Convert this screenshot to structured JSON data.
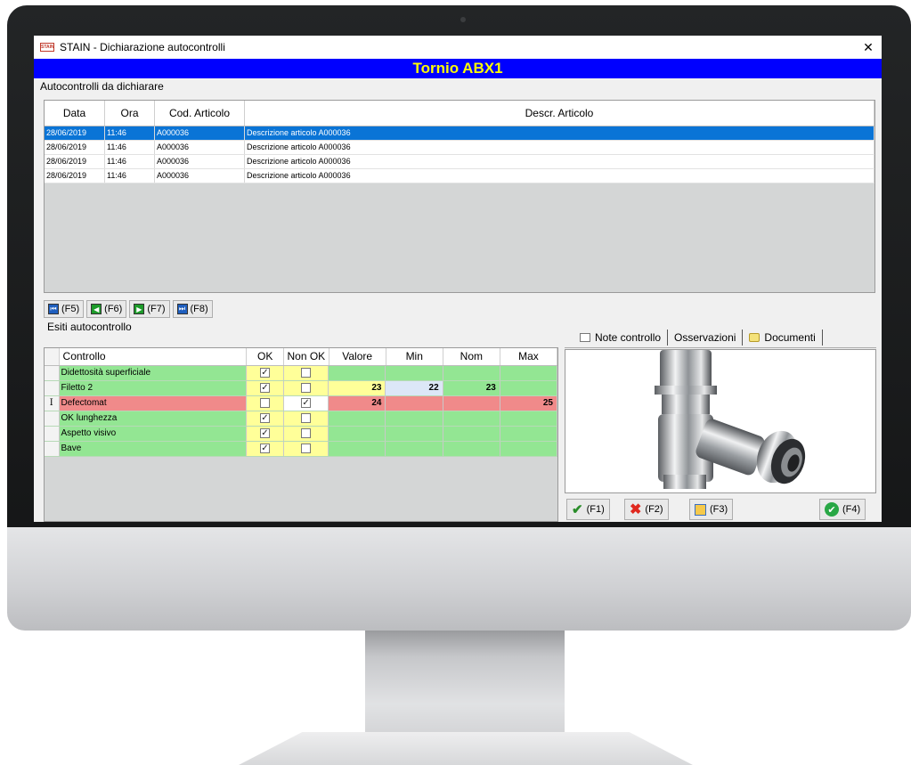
{
  "window": {
    "title": "STAIN - Dichiarazione autocontrolli",
    "app_logo_text": "STAIN",
    "close_glyph": "✕",
    "banner": "Tornio ABX1"
  },
  "pending": {
    "section_label": "Autocontrolli da dichiarare",
    "columns": [
      "Data",
      "Ora",
      "Cod. Articolo",
      "Descr. Articolo"
    ],
    "rows": [
      {
        "data": "28/06/2019",
        "ora": "11:46",
        "cod": "A000036",
        "descr": "Descrizione articolo A000036"
      },
      {
        "data": "28/06/2019",
        "ora": "11:46",
        "cod": "A000036",
        "descr": "Descrizione articolo A000036"
      },
      {
        "data": "28/06/2019",
        "ora": "11:46",
        "cod": "A000036",
        "descr": "Descrizione articolo A000036"
      },
      {
        "data": "28/06/2019",
        "ora": "11:46",
        "cod": "A000036",
        "descr": "Descrizione articolo A000036"
      }
    ],
    "selected_row": 0
  },
  "nav": {
    "first": "(F5)",
    "prev": "(F6)",
    "next": "(F7)",
    "last": "(F8)"
  },
  "results": {
    "section_label": "Esiti autocontrollo",
    "columns": [
      "Controllo",
      "OK",
      "Non OK",
      "Valore",
      "Min",
      "Nom",
      "Max"
    ],
    "rows": [
      {
        "controllo": "Didettosità superficiale",
        "ok": true,
        "nonok": false,
        "valore": "",
        "min": "",
        "nom": "",
        "max": "",
        "status": "ok"
      },
      {
        "controllo": "Filetto 2",
        "ok": true,
        "nonok": false,
        "valore": "23",
        "min": "22",
        "nom": "23",
        "max": "",
        "status": "ok"
      },
      {
        "controllo": "Defectomat",
        "ok": false,
        "nonok": true,
        "valore": "24",
        "min": "",
        "nom": "",
        "max": "25",
        "status": "ko",
        "row_marker": "I"
      },
      {
        "controllo": "OK lunghezza",
        "ok": true,
        "nonok": false,
        "valore": "",
        "min": "",
        "nom": "",
        "max": "",
        "status": "ok"
      },
      {
        "controllo": "Aspetto visivo",
        "ok": true,
        "nonok": false,
        "valore": "",
        "min": "",
        "nom": "",
        "max": "",
        "status": "ok"
      },
      {
        "controllo": "Bave",
        "ok": true,
        "nonok": false,
        "valore": "",
        "min": "",
        "nom": "",
        "max": "",
        "status": "ok"
      }
    ],
    "check_glyph": "✓"
  },
  "side_tabs": {
    "note": "Note controllo",
    "osservazioni": "Osservazioni",
    "documenti": "Documenti"
  },
  "actions": {
    "f1": "(F1)",
    "f2": "(F2)",
    "f3": "(F3)",
    "f4": "(F4)"
  },
  "colors": {
    "banner_bg": "#0000ff",
    "banner_text": "#ffff00",
    "selection": "#0a74d6",
    "row_ok": "#93e693",
    "row_ko": "#f08a8a",
    "cell_highlight": "#ffff99"
  }
}
